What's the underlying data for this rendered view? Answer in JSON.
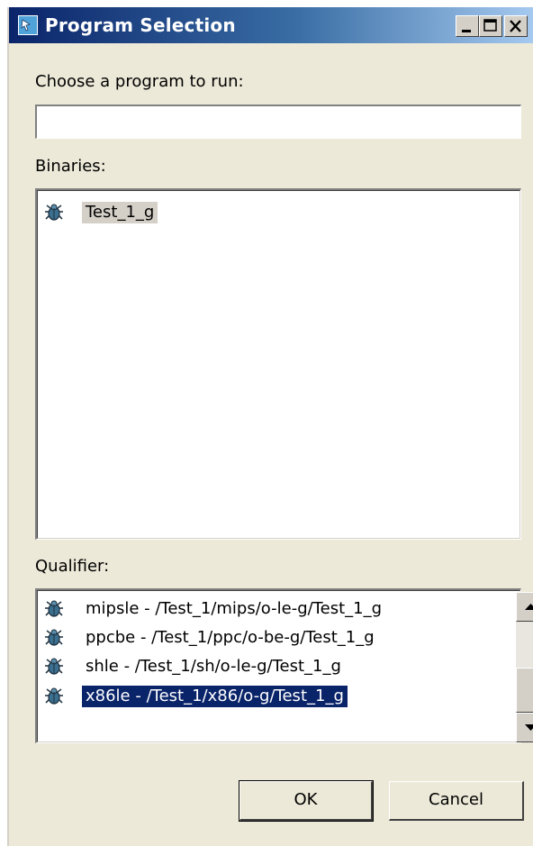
{
  "window": {
    "title": "Program Selection",
    "icon": "program-selection-icon",
    "controls": [
      "minimize-icon",
      "maximize-icon",
      "close-icon"
    ]
  },
  "program_field": {
    "label": "Choose a program to run:",
    "value": "",
    "placeholder": ""
  },
  "binaries": {
    "label": "Binaries:",
    "items": [
      {
        "label": "Test_1_g",
        "icon": "bug-icon",
        "selected": true
      }
    ]
  },
  "qualifier": {
    "label": "Qualifier:",
    "items": [
      {
        "label": "mipsle - /Test_1/mips/o-le-g/Test_1_g",
        "icon": "bug-icon",
        "selected": false
      },
      {
        "label": "ppcbe - /Test_1/ppc/o-be-g/Test_1_g",
        "icon": "bug-icon",
        "selected": false
      },
      {
        "label": "shle - /Test_1/sh/o-le-g/Test_1_g",
        "icon": "bug-icon",
        "selected": false
      },
      {
        "label": "x86le - /Test_1/x86/o-g/Test_1_g",
        "icon": "bug-icon",
        "selected": true
      }
    ],
    "scroll_position": 0.62
  },
  "buttons": {
    "ok": "OK",
    "cancel": "Cancel"
  }
}
